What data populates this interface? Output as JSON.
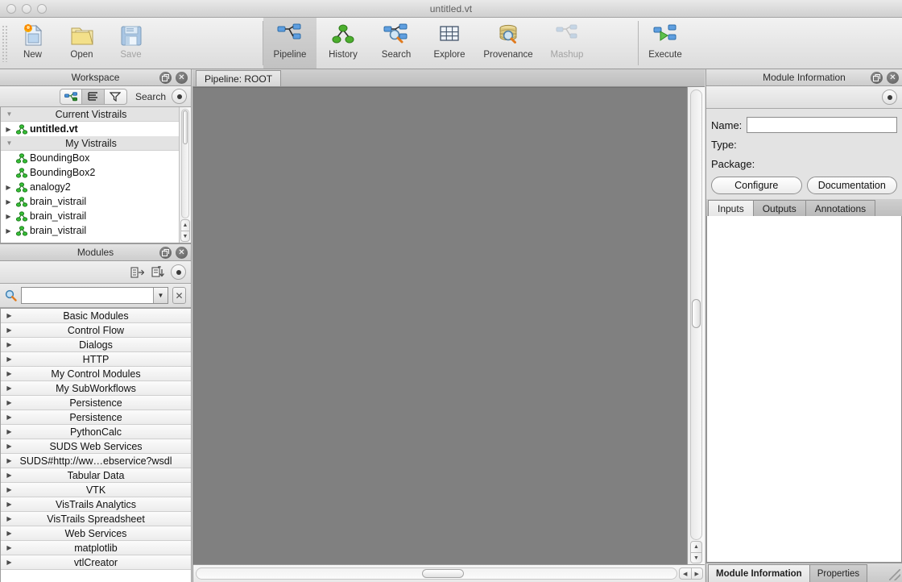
{
  "window": {
    "title": "untitled.vt"
  },
  "toolbar": {
    "file_buttons": [
      {
        "label": "New",
        "icon": "new-document-icon",
        "enabled": true
      },
      {
        "label": "Open",
        "icon": "open-folder-icon",
        "enabled": true
      },
      {
        "label": "Save",
        "icon": "floppy-disk-icon",
        "enabled": false
      }
    ],
    "view_buttons": [
      {
        "label": "Pipeline",
        "icon": "pipeline-icon",
        "active": true,
        "enabled": true
      },
      {
        "label": "History",
        "icon": "history-tree-icon",
        "active": false,
        "enabled": true
      },
      {
        "label": "Search",
        "icon": "search-magnifier-icon",
        "active": false,
        "enabled": true
      },
      {
        "label": "Explore",
        "icon": "explore-grid-icon",
        "active": false,
        "enabled": true
      },
      {
        "label": "Provenance",
        "icon": "provenance-database-icon",
        "active": false,
        "enabled": true
      },
      {
        "label": "Mashup",
        "icon": "mashup-icon",
        "active": false,
        "enabled": false
      }
    ],
    "execute_button": {
      "label": "Execute",
      "icon": "execute-play-icon",
      "enabled": true
    }
  },
  "workspace": {
    "title": "Workspace",
    "toolbar": {
      "pipeline_view_icon": "pipeline-small-icon",
      "list_view_icon": "list-view-icon",
      "filter_icon": "filter-funnel-icon",
      "search_label": "Search",
      "options_icon": "options-dot-icon",
      "undock_icon": "undock-icon",
      "close_icon": "close-icon"
    },
    "tree": [
      {
        "type": "group",
        "label": "Current Vistrails",
        "expanded": true
      },
      {
        "type": "item",
        "label": "untitled.vt",
        "bold": true,
        "has_children": true,
        "icon": "vistrail-icon"
      },
      {
        "type": "group",
        "label": "My Vistrails",
        "expanded": true
      },
      {
        "type": "item",
        "label": "BoundingBox",
        "bold": false,
        "has_children": false,
        "icon": "vistrail-icon"
      },
      {
        "type": "item",
        "label": "BoundingBox2",
        "bold": false,
        "has_children": false,
        "icon": "vistrail-icon"
      },
      {
        "type": "item",
        "label": "analogy2",
        "bold": false,
        "has_children": true,
        "icon": "vistrail-icon"
      },
      {
        "type": "item",
        "label": "brain_vistrail",
        "bold": false,
        "has_children": true,
        "icon": "vistrail-icon"
      },
      {
        "type": "item",
        "label": "brain_vistrail",
        "bold": false,
        "has_children": true,
        "icon": "vistrail-icon"
      },
      {
        "type": "item",
        "label": "brain_vistrail",
        "bold": false,
        "has_children": true,
        "icon": "vistrail-icon"
      }
    ]
  },
  "modules": {
    "title": "Modules",
    "toolbar": {
      "new_module_icon": "new-module-icon",
      "import_module_icon": "import-module-icon",
      "options_icon": "options-dot-icon",
      "undock_icon": "undock-icon",
      "close_icon": "close-icon"
    },
    "search": {
      "icon": "search-magnifier-icon",
      "value": "",
      "placeholder": "",
      "dropdown_icon": "chevron-down-icon",
      "clear_icon": "clear-x-icon"
    },
    "categories": [
      "Basic Modules",
      "Control Flow",
      "Dialogs",
      "HTTP",
      "My Control Modules",
      "My SubWorkflows",
      "Persistence",
      "Persistence",
      "PythonCalc",
      "SUDS Web Services",
      "SUDS#http://ww…ebservice?wsdl",
      "Tabular Data",
      "VTK",
      "VisTrails Analytics",
      "VisTrails Spreadsheet",
      "Web Services",
      "matplotlib",
      "vtlCreator"
    ]
  },
  "pipeline": {
    "tab_label": "Pipeline: ROOT",
    "canvas_color": "#808080"
  },
  "module_information": {
    "title": "Module Information",
    "toolbar": {
      "options_icon": "options-dot-icon",
      "undock_icon": "undock-icon",
      "close_icon": "close-icon"
    },
    "fields": {
      "name_label": "Name:",
      "name_value": "",
      "type_label": "Type:",
      "type_value": "",
      "package_label": "Package:",
      "package_value": ""
    },
    "buttons": {
      "configure": "Configure",
      "documentation": "Documentation"
    },
    "tabs": [
      {
        "label": "Inputs",
        "selected": true
      },
      {
        "label": "Outputs",
        "selected": false
      },
      {
        "label": "Annotations",
        "selected": false
      }
    ]
  },
  "bottom_tabs": [
    {
      "label": "Module Information",
      "selected": true
    },
    {
      "label": "Properties",
      "selected": false
    }
  ]
}
